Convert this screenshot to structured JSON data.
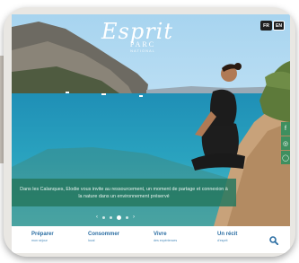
{
  "logo": {
    "script": "Esprit",
    "parc": "PARC",
    "sub": "NATIONAL"
  },
  "lang": {
    "fr": "FR",
    "en": "EN"
  },
  "social": {
    "facebook": "f",
    "instagram": "◎",
    "other": "◯"
  },
  "caption": "Dans les Calanques, Elodie vous invite au ressourcement, un moment de partage et connexion à la nature dans un environnement préservé",
  "slider": {
    "prev": "‹",
    "next": "›",
    "count": 4,
    "active_index": 2
  },
  "nav": {
    "items": [
      {
        "title": "Préparer",
        "subtitle": "mon séjour"
      },
      {
        "title": "Consommer",
        "subtitle": "local"
      },
      {
        "title": "Vivre",
        "subtitle": "des expériences"
      },
      {
        "title": "Un récit",
        "subtitle": "d'esprit"
      }
    ],
    "search_icon": "search-icon"
  },
  "colors": {
    "accent": "#2b6ea3",
    "caption_bg": "#26785f",
    "social_bg": "#3f8f5f"
  }
}
